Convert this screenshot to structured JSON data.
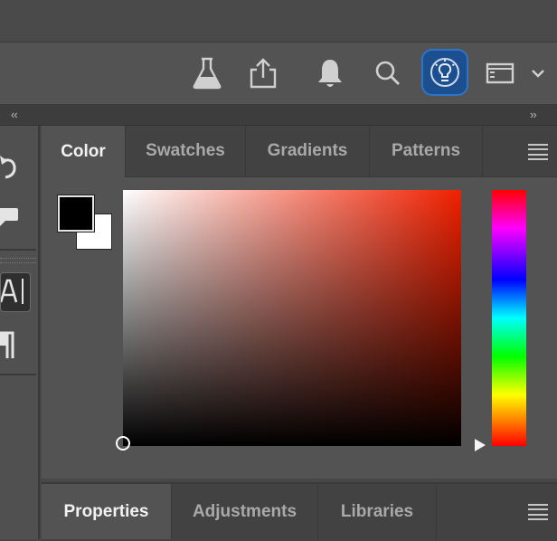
{
  "toolbar": {
    "icons": [
      "flask-icon",
      "share-icon",
      "bell-icon",
      "search-icon",
      "lightbulb-icon",
      "workspace-icon",
      "chevron-down-icon"
    ]
  },
  "collapse": {
    "left": "‹‹",
    "right": "››"
  },
  "color_panel": {
    "tabs": [
      "Color",
      "Swatches",
      "Gradients",
      "Patterns"
    ],
    "active_tab": "Color",
    "foreground_color": "#000000",
    "background_color": "#ffffff",
    "hue_color": "#f02000"
  },
  "properties_panel": {
    "tabs": [
      "Properties",
      "Adjustments",
      "Libraries"
    ],
    "active_tab": "Properties"
  },
  "accent_color": "#1c4f8f"
}
